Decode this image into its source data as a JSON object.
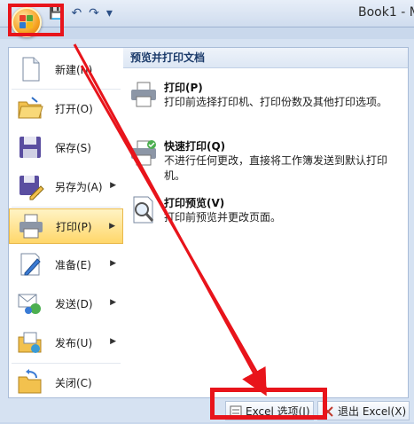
{
  "title_bar": {
    "title": "Book1 - M"
  },
  "office_button": {
    "icon": "office-logo-icon"
  },
  "quick_access": {
    "icons": [
      "save-icon",
      "undo-icon",
      "redo-icon",
      "customize-icon"
    ]
  },
  "left_menu": {
    "items": [
      {
        "label": "新建(N)",
        "icon": "new-document-icon",
        "has_arrow": false
      },
      {
        "label": "打开(O)",
        "icon": "open-folder-icon",
        "has_arrow": false
      },
      {
        "label": "保存(S)",
        "icon": "save-disk-icon",
        "has_arrow": false
      },
      {
        "label": "另存为(A)",
        "icon": "save-as-icon",
        "has_arrow": true
      },
      {
        "label": "打印(P)",
        "icon": "printer-icon",
        "has_arrow": true,
        "selected": true
      },
      {
        "label": "准备(E)",
        "icon": "prepare-icon",
        "has_arrow": true
      },
      {
        "label": "发送(D)",
        "icon": "send-icon",
        "has_arrow": true
      },
      {
        "label": "发布(U)",
        "icon": "publish-icon",
        "has_arrow": true
      },
      {
        "label": "关闭(C)",
        "icon": "close-folder-icon",
        "has_arrow": false
      }
    ]
  },
  "right_panel": {
    "header": "预览并打印文档",
    "items": [
      {
        "title": "打印(P)",
        "desc": "打印前选择打印机、打印份数及其他打印选项。",
        "icon": "printer-icon"
      },
      {
        "title": "快速打印(Q)",
        "desc": "不进行任何更改，直接将工作簿发送到默认打印机。",
        "icon": "quick-print-icon"
      },
      {
        "title": "打印预览(V)",
        "desc": "打印前预览并更改页面。",
        "icon": "print-preview-icon"
      }
    ]
  },
  "bottom_bar": {
    "excel_options": "Excel 选项(I)",
    "exit_excel": "退出 Excel(X)"
  },
  "colors": {
    "highlight": "#e8141b",
    "selected_bg": "#ffd76a",
    "header_text": "#1a3a6a"
  }
}
